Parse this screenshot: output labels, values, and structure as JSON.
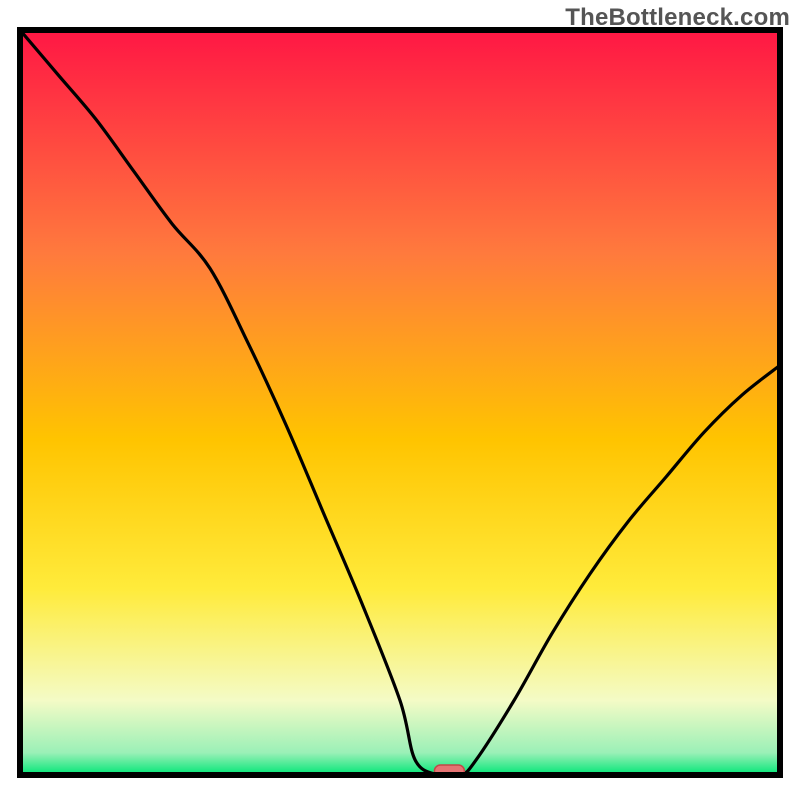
{
  "watermark": "TheBottleneck.com",
  "colors": {
    "gradient_top": "#ff1744",
    "gradient_mid1": "#ff6e40",
    "gradient_mid2": "#ffc400",
    "gradient_mid3": "#ffeb3b",
    "gradient_bottom_pale": "#f4fbc6",
    "gradient_green": "#00e676",
    "frame": "#000000",
    "curve": "#000000",
    "marker_fill": "#e57373",
    "marker_stroke": "#c24848"
  },
  "chart_data": {
    "type": "line",
    "title": "",
    "xlabel": "",
    "ylabel": "",
    "xlim": [
      0,
      100
    ],
    "ylim": [
      0,
      100
    ],
    "grid": false,
    "legend": false,
    "optimum_x": 56,
    "series": [
      {
        "name": "bottleneck-curve",
        "x": [
          0,
          5,
          10,
          15,
          20,
          25,
          30,
          35,
          40,
          45,
          50,
          52,
          55,
          58,
          60,
          65,
          70,
          75,
          80,
          85,
          90,
          95,
          100
        ],
        "y": [
          100,
          94,
          88,
          81,
          74,
          68,
          58,
          47,
          35,
          23,
          10,
          2,
          0,
          0,
          2,
          10,
          19,
          27,
          34,
          40,
          46,
          51,
          55
        ]
      }
    ],
    "marker": {
      "x": 56.5,
      "y": 0
    },
    "annotations": []
  }
}
